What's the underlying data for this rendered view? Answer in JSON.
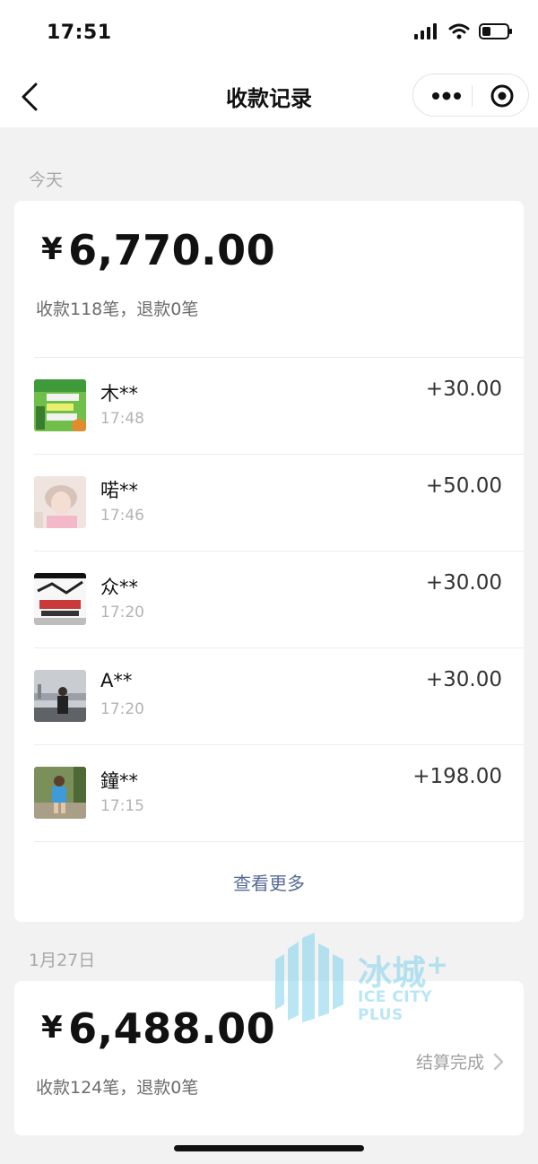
{
  "status_bar": {
    "time": "17:51"
  },
  "nav": {
    "title": "收款记录"
  },
  "today": {
    "label": "今天",
    "currency": "¥",
    "total": "6,770.00",
    "summary": "收款118笔，退款0笔",
    "transactions": [
      {
        "name": "木**",
        "time": "17:48",
        "amount": "+30.00"
      },
      {
        "name": "喏**",
        "time": "17:46",
        "amount": "+50.00"
      },
      {
        "name": "众**",
        "time": "17:20",
        "amount": "+30.00"
      },
      {
        "name": "A**",
        "time": "17:20",
        "amount": "+30.00"
      },
      {
        "name": "鐘**",
        "time": "17:15",
        "amount": "+198.00"
      }
    ],
    "view_more": "查看更多"
  },
  "jan27": {
    "label": "1月27日",
    "currency": "¥",
    "total": "6,488.00",
    "summary": "收款124笔，退款0笔",
    "status": "结算完成"
  },
  "watermark": {
    "cn": "冰城",
    "plus": "+",
    "en": "ICE CITY PLUS"
  },
  "colors": {
    "link": "#576b95",
    "watermark": "#7fd3ee"
  }
}
